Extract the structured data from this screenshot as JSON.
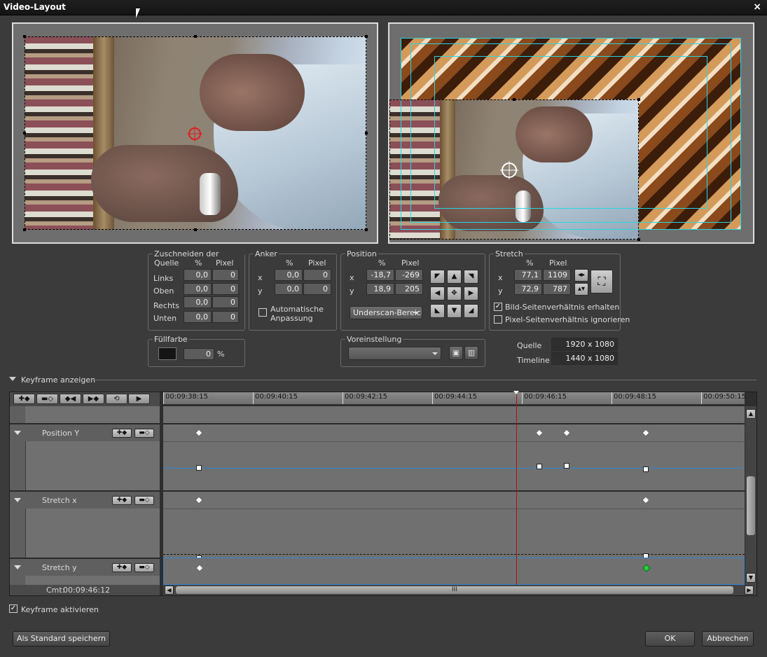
{
  "window": {
    "title": "Video-Layout",
    "close": "×"
  },
  "crop": {
    "title": "Zuschneiden der Quelle",
    "col_pct": "%",
    "col_px": "Pixel",
    "rows": [
      {
        "label": "Links",
        "pct": "0,0",
        "px": "0"
      },
      {
        "label": "Oben",
        "pct": "0,0",
        "px": "0"
      },
      {
        "label": "Rechts",
        "pct": "0,0",
        "px": "0"
      },
      {
        "label": "Unten",
        "pct": "0,0",
        "px": "0"
      }
    ]
  },
  "anchor": {
    "title": "Anker",
    "col_pct": "%",
    "col_px": "Pixel",
    "x_label": "x",
    "x_pct": "0,0",
    "x_px": "0",
    "y_label": "y",
    "y_pct": "0,0",
    "y_px": "0",
    "auto_line1": "Automatische",
    "auto_line2": "Anpassung"
  },
  "position": {
    "title": "Position",
    "col_pct": "%",
    "col_px": "Pixel",
    "x_label": "x",
    "x_pct": "-18,7",
    "x_px": "-269",
    "y_label": "y",
    "y_pct": "18,9",
    "y_px": "205",
    "combo": "Underscan-Bereich"
  },
  "stretch": {
    "title": "Stretch",
    "col_pct": "%",
    "col_px": "Pixel",
    "x_label": "x",
    "x_pct": "77,1",
    "x_px": "1109",
    "y_label": "y",
    "y_pct": "72,9",
    "y_px": "787",
    "keep_aspect": "Bild-Seitenverhältnis erhalten",
    "ignore_pixel": "Pixel-Seitenverhältnis ignorieren"
  },
  "fill": {
    "title": "Füllfarbe",
    "value": "0",
    "unit": "%",
    "color": "#151515"
  },
  "preset": {
    "title": "Voreinstellung",
    "value": ""
  },
  "info": {
    "source_label": "Quelle",
    "source_value": "1920 x 1080",
    "timeline_label": "Timeline",
    "timeline_value": "1440 x 1080"
  },
  "keyframe_toggle": "Keyframe anzeigen",
  "timeline": {
    "ticks": [
      "00:09:38:15",
      "00:09:40:15",
      "00:09:42:15",
      "00:09:44:15",
      "00:09:46:15",
      "00:09:48:15",
      "00:09:50:15"
    ],
    "tracks": [
      {
        "name": "Position Y"
      },
      {
        "name": "Stretch x"
      },
      {
        "name": "Stretch y"
      }
    ],
    "cmt_label": "Cmt:",
    "cmt_value": "00:09:46:12",
    "scroll_grip": "III"
  },
  "keyframe_enable": "Keyframe aktivieren",
  "buttons": {
    "save_default": "Als Standard speichern",
    "ok": "OK",
    "cancel": "Abbrechen"
  },
  "icons": {
    "check": "✓"
  }
}
